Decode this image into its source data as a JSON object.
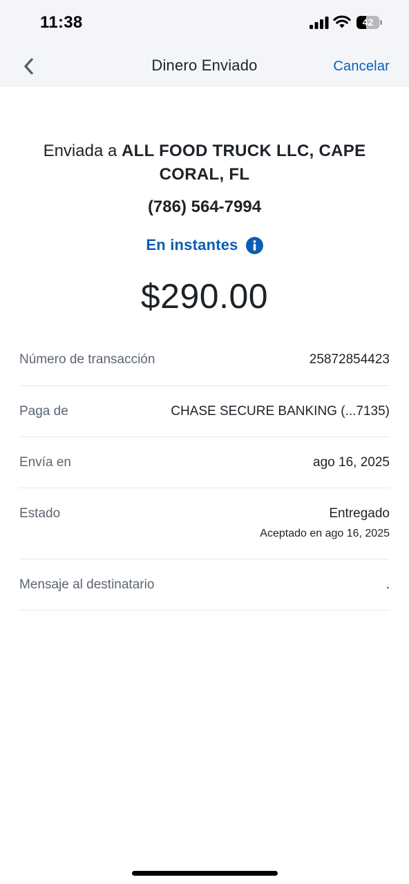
{
  "status_bar": {
    "time": "11:38",
    "battery_level": "42",
    "icons": [
      "cellular-signal-icon",
      "wifi-icon",
      "battery-icon"
    ]
  },
  "nav": {
    "title": "Dinero Enviado",
    "cancel_label": "Cancelar",
    "back_icon": "chevron-left-icon"
  },
  "summary": {
    "recipient_prefix": "Enviada a ",
    "recipient_name": "ALL FOOD TRUCK LLC, CAPE CORAL, FL",
    "phone": "(786) 564-7994",
    "speed_label": "En instantes",
    "speed_icon": "info-icon",
    "amount": "$290.00"
  },
  "details": [
    {
      "label": "Número de transacción",
      "value": "25872854423"
    },
    {
      "label": "Paga de",
      "value": "CHASE SECURE BANKING (...7135)"
    },
    {
      "label": "Envía en",
      "value": "ago 16, 2025"
    },
    {
      "label": "Estado",
      "value": "Entregado",
      "sub": "Aceptado en ago 16, 2025"
    },
    {
      "label": "Mensaje al destinatario",
      "value": "."
    }
  ],
  "colors": {
    "accent": "#0b5fb3",
    "header_bg": "#f3f5f8",
    "text": "#1d2228",
    "muted": "#5b6572",
    "divider": "#e4e7eb"
  }
}
